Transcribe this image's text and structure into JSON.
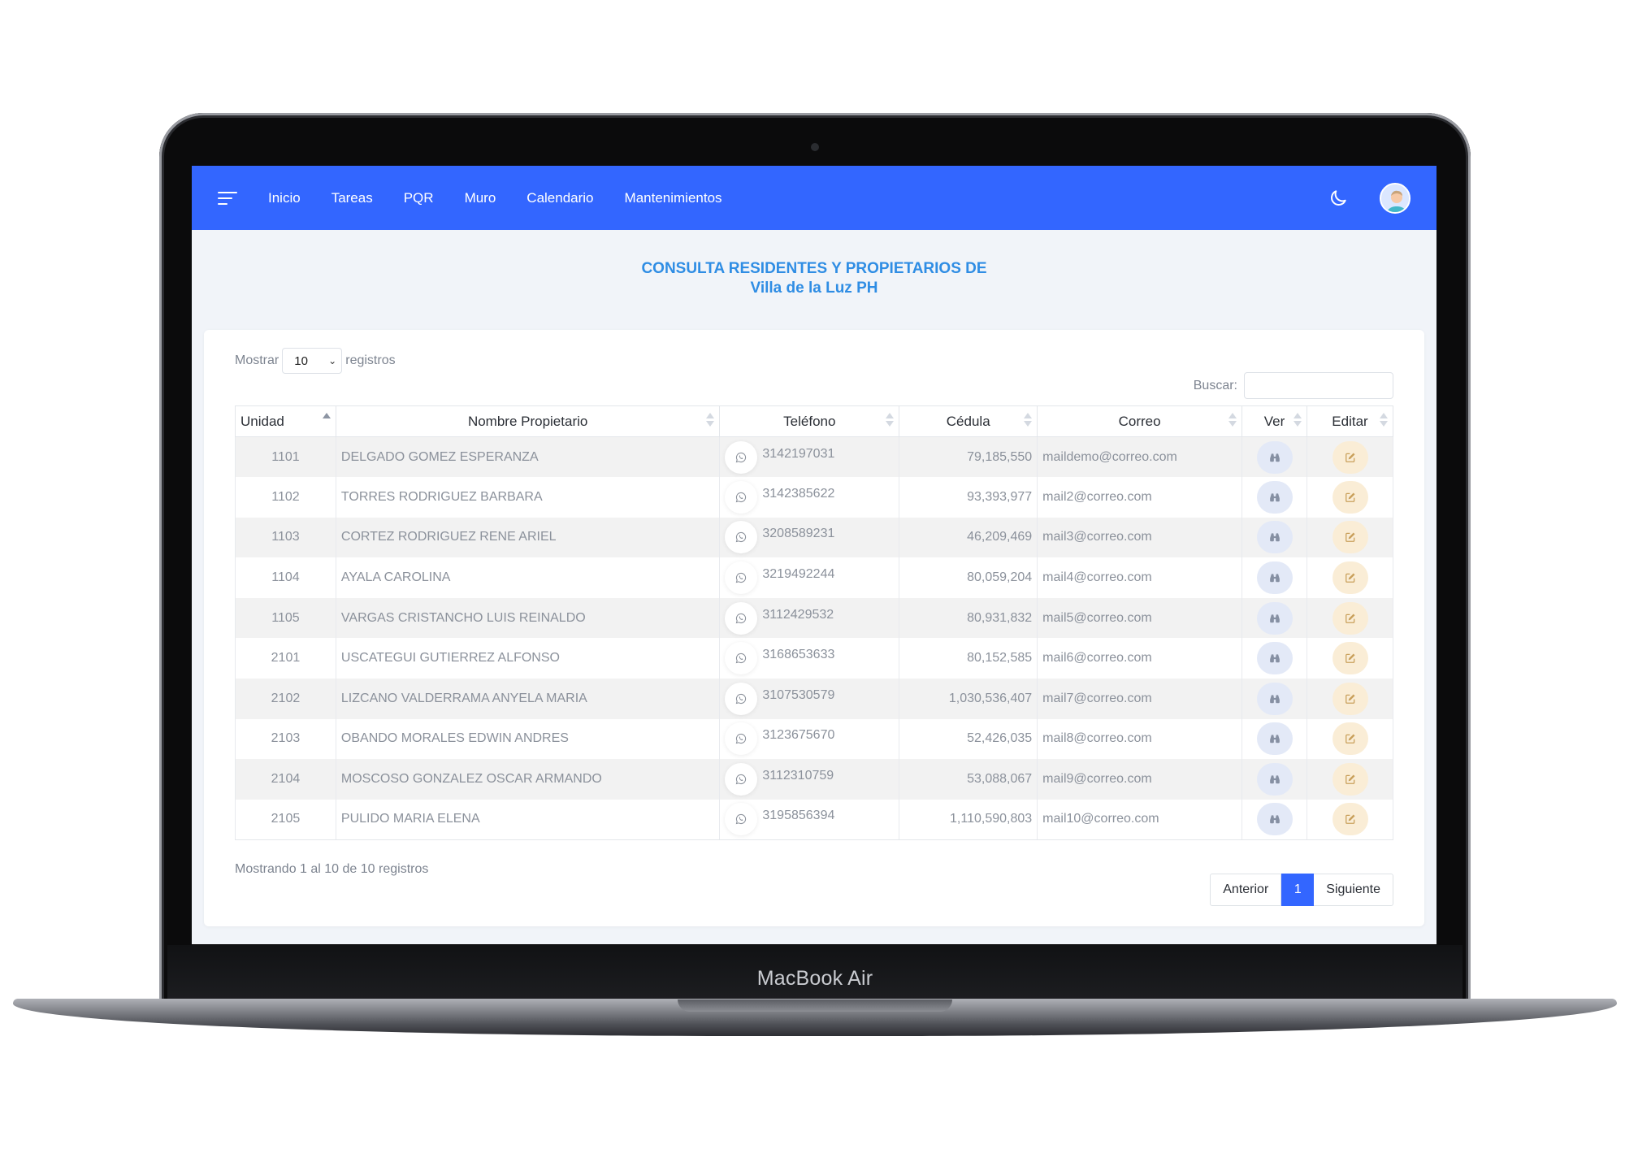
{
  "nav": {
    "links": [
      "Inicio",
      "Tareas",
      "PQR",
      "Muro",
      "Calendario",
      "Mantenimientos"
    ]
  },
  "title": {
    "line1": "CONSULTA RESIDENTES Y PROPIETARIOS DE",
    "line2": "Villa de la Luz PH"
  },
  "controls": {
    "show_label": "Mostrar",
    "show_value": "10",
    "records_label": "registros",
    "search_label": "Buscar:",
    "search_value": ""
  },
  "table": {
    "headers": [
      "Unidad",
      "Nombre Propietario",
      "Teléfono",
      "Cédula",
      "Correo",
      "Ver",
      "Editar"
    ],
    "rows": [
      {
        "unidad": "1101",
        "nombre": "DELGADO GOMEZ ESPERANZA",
        "telefono": "3142197031",
        "cedula": "79,185,550",
        "correo": "maildemo@correo.com"
      },
      {
        "unidad": "1102",
        "nombre": "TORRES RODRIGUEZ BARBARA",
        "telefono": "3142385622",
        "cedula": "93,393,977",
        "correo": "mail2@correo.com"
      },
      {
        "unidad": "1103",
        "nombre": "CORTEZ RODRIGUEZ RENE ARIEL",
        "telefono": "3208589231",
        "cedula": "46,209,469",
        "correo": "mail3@correo.com"
      },
      {
        "unidad": "1104",
        "nombre": "AYALA CAROLINA",
        "telefono": "3219492244",
        "cedula": "80,059,204",
        "correo": "mail4@correo.com"
      },
      {
        "unidad": "1105",
        "nombre": "VARGAS CRISTANCHO LUIS REINALDO",
        "telefono": "3112429532",
        "cedula": "80,931,832",
        "correo": "mail5@correo.com"
      },
      {
        "unidad": "2101",
        "nombre": "USCATEGUI GUTIERREZ ALFONSO",
        "telefono": "3168653633",
        "cedula": "80,152,585",
        "correo": "mail6@correo.com"
      },
      {
        "unidad": "2102",
        "nombre": "LIZCANO VALDERRAMA ANYELA MARIA",
        "telefono": "3107530579",
        "cedula": "1,030,536,407",
        "correo": "mail7@correo.com"
      },
      {
        "unidad": "2103",
        "nombre": "OBANDO MORALES EDWIN ANDRES",
        "telefono": "3123675670",
        "cedula": "52,426,035",
        "correo": "mail8@correo.com"
      },
      {
        "unidad": "2104",
        "nombre": "MOSCOSO GONZALEZ OSCAR ARMANDO",
        "telefono": "3112310759",
        "cedula": "53,088,067",
        "correo": "mail9@correo.com"
      },
      {
        "unidad": "2105",
        "nombre": "PULIDO MARIA ELENA",
        "telefono": "3195856394",
        "cedula": "1,110,590,803",
        "correo": "mail10@correo.com"
      }
    ]
  },
  "footer": {
    "info": "Mostrando 1 al 10 de 10 registros",
    "prev": "Anterior",
    "page": "1",
    "next": "Siguiente"
  },
  "device": {
    "brand": "MacBook Air"
  },
  "colors": {
    "navbar": "#3366ff",
    "title": "#2f8de4",
    "page_active": "#3366ff"
  }
}
